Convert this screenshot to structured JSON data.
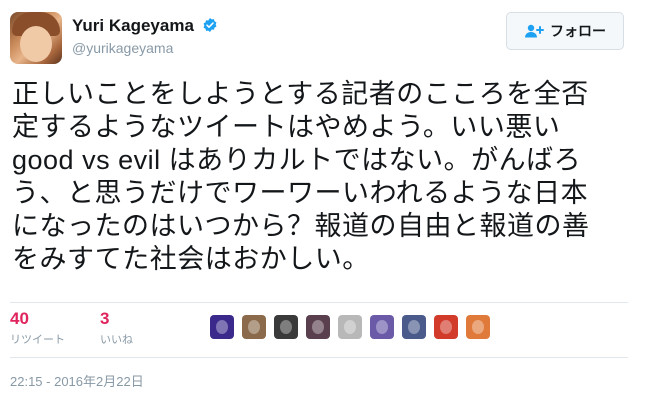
{
  "user": {
    "display_name": "Yuri Kageyama",
    "handle": "@yurikageyama",
    "verified": true
  },
  "follow_button": {
    "label": "フォロー"
  },
  "tweet": {
    "lines": [
      "正しいことをしようとする記者のこころを全否",
      "定するようなツイートはやめよう。いい悪い",
      "good vs evil はありカルトではない。がんばろ",
      "う、と思うだけでワーワーいわれるような日本",
      "になったのはいつから？報道の自由と報道の善",
      "をみすてた社会はおかしい。"
    ]
  },
  "stats": {
    "retweets": {
      "count": "40",
      "label": "リツイート"
    },
    "likes": {
      "count": "3",
      "label": "いいね"
    }
  },
  "liker_avatars": [
    {
      "icon": "likert-avatar-1",
      "color": "#3b2a8c"
    },
    {
      "icon": "likert-avatar-2",
      "color": "#8a6a4a"
    },
    {
      "icon": "likert-avatar-3",
      "color": "#3a3a3a"
    },
    {
      "icon": "likert-avatar-4",
      "color": "#5a3f4f"
    },
    {
      "icon": "likert-avatar-5",
      "color": "#b8b8b8"
    },
    {
      "icon": "likert-avatar-6",
      "color": "#6a5aa8"
    },
    {
      "icon": "likert-avatar-7",
      "color": "#4a5a8a"
    },
    {
      "icon": "likert-avatar-8",
      "color": "#d23a2a"
    },
    {
      "icon": "likert-avatar-9",
      "color": "#e07a3a"
    }
  ],
  "timestamp": "22:15 - 2016年2月22日",
  "colors": {
    "accent_like": "#e0245e",
    "verified_blue": "#1da1f2",
    "muted": "#8899a6"
  }
}
